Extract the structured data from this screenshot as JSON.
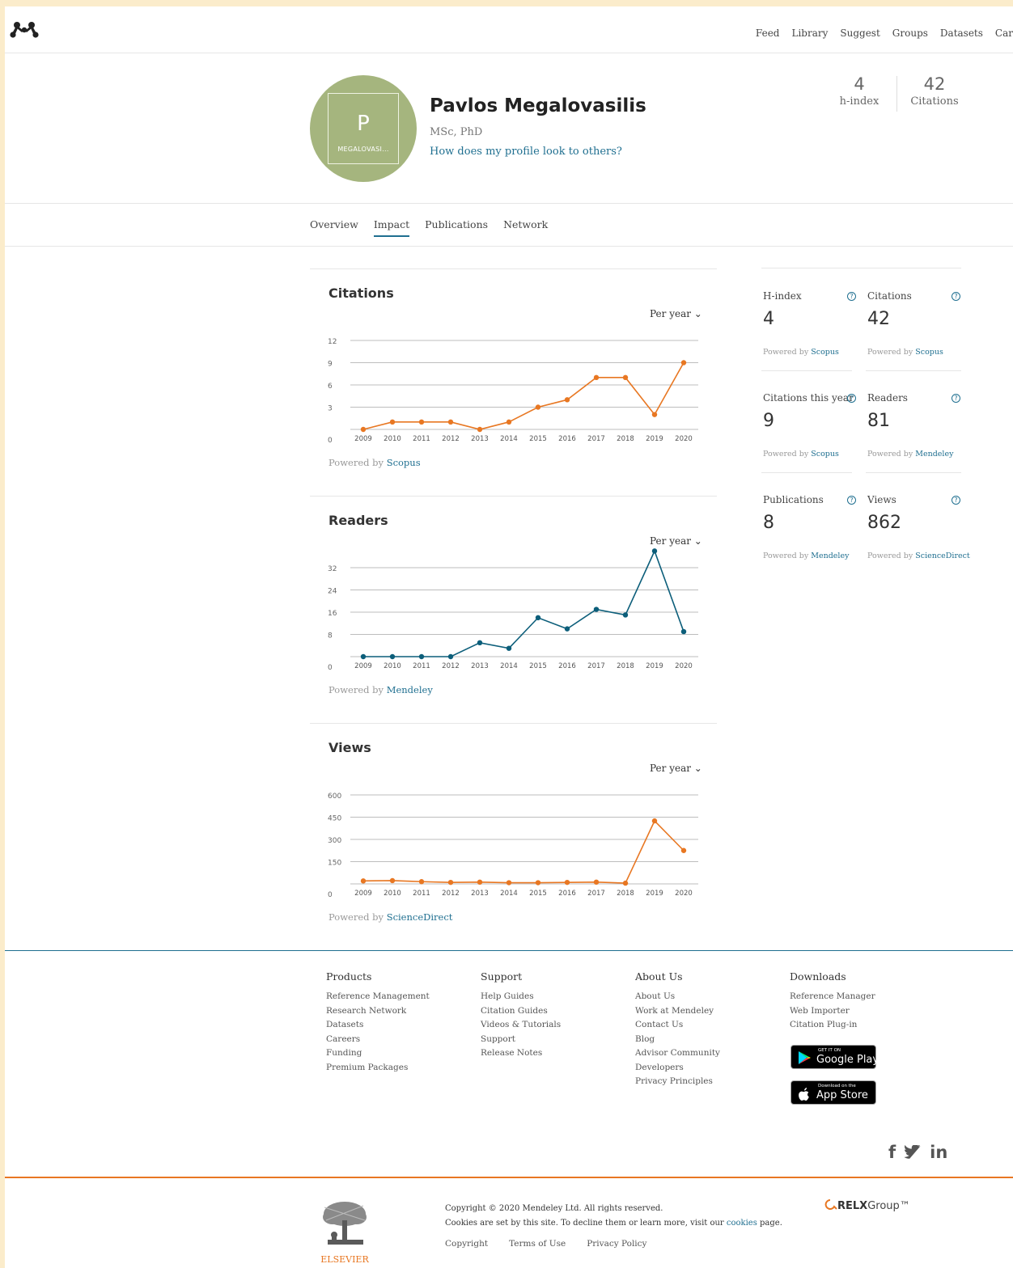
{
  "nav": {
    "items": [
      "Feed",
      "Library",
      "Suggest",
      "Groups",
      "Datasets",
      "Car"
    ]
  },
  "profile": {
    "initial": "P",
    "avatar_caption": "MEGALOVASI...",
    "name": "Pavlos Megalovasilis",
    "degrees": "MSc, PhD",
    "preview_link": "How does my profile look to others?",
    "avatar_color": "#a5b57e"
  },
  "header_stats": [
    {
      "value": "4",
      "label": "h-index"
    },
    {
      "value": "42",
      "label": "Citations"
    }
  ],
  "tabs": [
    "Overview",
    "Impact",
    "Publications",
    "Network"
  ],
  "active_tab": "Impact",
  "charts": [
    {
      "title": "Citations",
      "period": "Per year",
      "powered_prefix": "Powered by",
      "powered_source": "Scopus",
      "color": "#e87722"
    },
    {
      "title": "Readers",
      "period": "Per year",
      "powered_prefix": "Powered by",
      "powered_source": "Mendeley",
      "color": "#0c5e7a"
    },
    {
      "title": "Views",
      "period": "Per year",
      "powered_prefix": "Powered by",
      "powered_source": "ScienceDirect",
      "color": "#e87722"
    }
  ],
  "chart_data": [
    {
      "type": "line",
      "title": "Citations",
      "categories": [
        "2009",
        "2010",
        "2011",
        "2012",
        "2013",
        "2014",
        "2015",
        "2016",
        "2017",
        "2018",
        "2019",
        "2020"
      ],
      "values": [
        0,
        1,
        1,
        1,
        0,
        1,
        3,
        4,
        7,
        7,
        2,
        9
      ],
      "yticks": [
        0,
        3,
        6,
        9,
        12
      ],
      "ylim": [
        0,
        12
      ],
      "grid": true
    },
    {
      "type": "line",
      "title": "Readers",
      "categories": [
        "2009",
        "2010",
        "2011",
        "2012",
        "2013",
        "2014",
        "2015",
        "2016",
        "2017",
        "2018",
        "2019",
        "2020"
      ],
      "values": [
        0,
        0,
        0,
        0,
        5,
        3,
        14,
        10,
        17,
        15,
        38,
        9
      ],
      "yticks": [
        0,
        8,
        16,
        24,
        32
      ],
      "ylim": [
        0,
        32
      ],
      "grid": true
    },
    {
      "type": "line",
      "title": "Views",
      "categories": [
        "2009",
        "2010",
        "2011",
        "2012",
        "2013",
        "2014",
        "2015",
        "2016",
        "2017",
        "2018",
        "2019",
        "2020"
      ],
      "values": [
        20,
        22,
        15,
        10,
        12,
        8,
        8,
        10,
        12,
        5,
        425,
        225
      ],
      "yticks": [
        0,
        150,
        300,
        450,
        600
      ],
      "ylim": [
        0,
        600
      ],
      "grid": true
    }
  ],
  "side_stats": [
    {
      "label": "H-index",
      "value": "4",
      "powered_prefix": "Powered by",
      "source": "Scopus"
    },
    {
      "label": "Citations",
      "value": "42",
      "powered_prefix": "Powered by",
      "source": "Scopus"
    },
    {
      "label": "Citations this year",
      "value": "9",
      "powered_prefix": "Powered by",
      "source": "Scopus"
    },
    {
      "label": "Readers",
      "value": "81",
      "powered_prefix": "Powered by",
      "source": "Mendeley"
    },
    {
      "label": "Publications",
      "value": "8",
      "powered_prefix": "Powered by",
      "source": "Mendeley"
    },
    {
      "label": "Views",
      "value": "862",
      "powered_prefix": "Powered by",
      "source": "ScienceDirect"
    }
  ],
  "help_glyph": "?",
  "footer": {
    "columns": [
      {
        "heading": "Products",
        "items": [
          "Reference Management",
          "Research Network",
          "Datasets",
          "Careers",
          "Funding",
          "Premium Packages"
        ]
      },
      {
        "heading": "Support",
        "items": [
          "Help Guides",
          "Citation Guides",
          "Videos & Tutorials",
          "Support",
          "Release Notes"
        ]
      },
      {
        "heading": "About Us",
        "items": [
          "About Us",
          "Work at Mendeley",
          "Contact Us",
          "Blog",
          "Advisor Community",
          "Developers",
          "Privacy Principles"
        ]
      },
      {
        "heading": "Downloads",
        "items": [
          "Reference Manager",
          "Web Importer",
          "Citation Plug-in"
        ]
      }
    ],
    "google_play": {
      "small": "GET IT ON",
      "big": "Google Play"
    },
    "app_store": {
      "small": "Download on the",
      "big": "App Store"
    },
    "social": [
      "f",
      "in"
    ],
    "copyright_line": "Copyright © 2020 Mendeley Ltd. All rights reserved.",
    "cookies_prefix": "Cookies are set by this site. To decline them or learn more, visit our",
    "cookies_link": "cookies",
    "cookies_suffix": "page.",
    "links": [
      "Copyright",
      "Terms of Use",
      "Privacy Policy"
    ],
    "elsevier_text": "ELSEVIER",
    "relx_bold": "RELX",
    "relx_rest": "Group™",
    "accent": "#e87722",
    "link_color": "#1f6f90"
  }
}
